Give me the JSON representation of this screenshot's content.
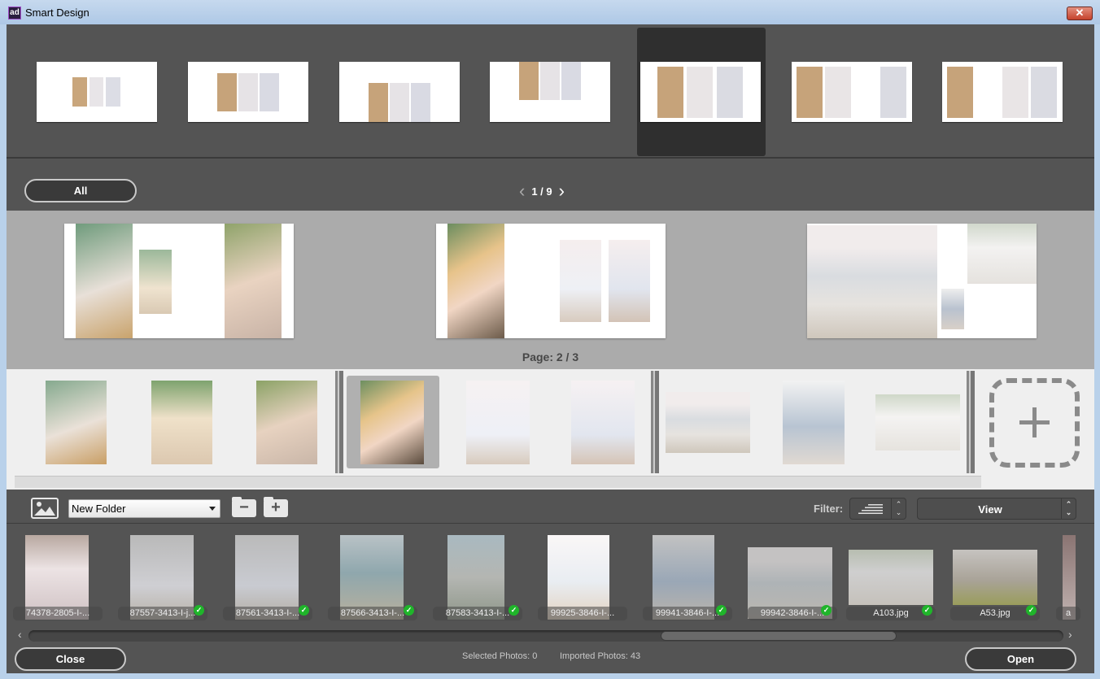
{
  "window": {
    "title": "Smart Design",
    "app_icon": "ad-logo-icon",
    "close_icon": "close-x-icon"
  },
  "layouts": {
    "selected_index": 4,
    "items": [
      {
        "name": "layout-1"
      },
      {
        "name": "layout-2"
      },
      {
        "name": "layout-3"
      },
      {
        "name": "layout-4"
      },
      {
        "name": "layout-5"
      },
      {
        "name": "layout-6"
      },
      {
        "name": "layout-7"
      }
    ]
  },
  "nav": {
    "all_label": "All",
    "prev_icon": "chevron-left-icon",
    "next_icon": "chevron-right-icon",
    "page_counter": "1 / 9"
  },
  "preview": {
    "page_label": "Page: 2 / 3",
    "spreads": [
      {
        "name": "spread-1",
        "photos": [
          "bouquet-bride",
          "bride-flowers",
          "bride-garden"
        ]
      },
      {
        "name": "spread-2",
        "photos": [
          "couple-closeup",
          "bride-beach-back",
          "couple-beach"
        ]
      },
      {
        "name": "spread-3",
        "photos": [
          "couple-kiss-beach",
          "couple-tree",
          "couple-kiss-small"
        ]
      }
    ]
  },
  "page_strip": {
    "groups": [
      {
        "photos": [
          "bouquet-bride",
          "bride-flowers",
          "bride-garden"
        ]
      },
      {
        "photos": [
          "couple-closeup",
          "bride-beach-back",
          "couple-beach"
        ],
        "selected_photo": 0
      },
      {
        "photos": [
          "couple-kiss-beach",
          "couple-kiss-suit",
          "couple-tree"
        ]
      }
    ],
    "add_page_icon": "add-page-plus-icon"
  },
  "toolbar": {
    "image_icon": "image-icon",
    "folder_value": "New Folder",
    "remove_folder_icon": "folder-minus-icon",
    "add_folder_icon": "folder-plus-icon",
    "filter_label": "Filter:",
    "filter_icon": "filter-lines-icon",
    "view_label": "View"
  },
  "photos": [
    {
      "label": "74378-2805-I-...",
      "imported": false
    },
    {
      "label": "87557-3413-I-j...",
      "imported": true
    },
    {
      "label": "87561-3413-I-...",
      "imported": true
    },
    {
      "label": "87566-3413-I-...",
      "imported": true
    },
    {
      "label": "87583-3413-I-...",
      "imported": true
    },
    {
      "label": "99925-3846-I-...",
      "imported": false
    },
    {
      "label": "99941-3846-I-...",
      "imported": true
    },
    {
      "label": "99942-3846-I-...",
      "imported": true
    },
    {
      "label": "A103.jpg",
      "imported": true
    },
    {
      "label": "A53.jpg",
      "imported": true
    },
    {
      "label": "a",
      "imported": false
    }
  ],
  "footer": {
    "close_label": "Close",
    "open_label": "Open",
    "selected_photos": "Selected Photos: 0",
    "imported_photos": "Imported Photos: 43"
  }
}
